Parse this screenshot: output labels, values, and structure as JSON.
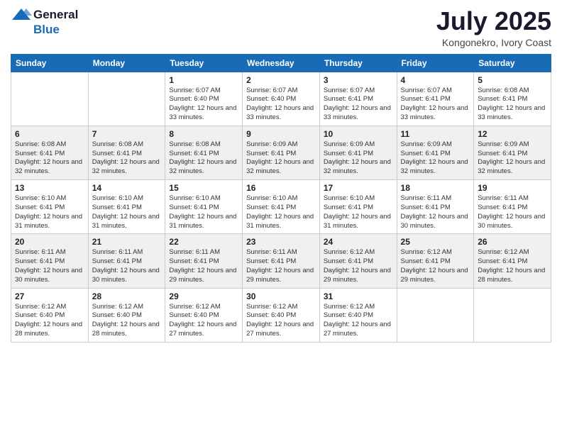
{
  "logo": {
    "general": "General",
    "blue": "Blue"
  },
  "title": {
    "month": "July 2025",
    "location": "Kongonekro, Ivory Coast"
  },
  "weekdays": [
    "Sunday",
    "Monday",
    "Tuesday",
    "Wednesday",
    "Thursday",
    "Friday",
    "Saturday"
  ],
  "weeks": [
    [
      {
        "day": "",
        "detail": ""
      },
      {
        "day": "",
        "detail": ""
      },
      {
        "day": "1",
        "detail": "Sunrise: 6:07 AM\nSunset: 6:40 PM\nDaylight: 12 hours and 33 minutes."
      },
      {
        "day": "2",
        "detail": "Sunrise: 6:07 AM\nSunset: 6:40 PM\nDaylight: 12 hours and 33 minutes."
      },
      {
        "day": "3",
        "detail": "Sunrise: 6:07 AM\nSunset: 6:41 PM\nDaylight: 12 hours and 33 minutes."
      },
      {
        "day": "4",
        "detail": "Sunrise: 6:07 AM\nSunset: 6:41 PM\nDaylight: 12 hours and 33 minutes."
      },
      {
        "day": "5",
        "detail": "Sunrise: 6:08 AM\nSunset: 6:41 PM\nDaylight: 12 hours and 33 minutes."
      }
    ],
    [
      {
        "day": "6",
        "detail": "Sunrise: 6:08 AM\nSunset: 6:41 PM\nDaylight: 12 hours and 32 minutes."
      },
      {
        "day": "7",
        "detail": "Sunrise: 6:08 AM\nSunset: 6:41 PM\nDaylight: 12 hours and 32 minutes."
      },
      {
        "day": "8",
        "detail": "Sunrise: 6:08 AM\nSunset: 6:41 PM\nDaylight: 12 hours and 32 minutes."
      },
      {
        "day": "9",
        "detail": "Sunrise: 6:09 AM\nSunset: 6:41 PM\nDaylight: 12 hours and 32 minutes."
      },
      {
        "day": "10",
        "detail": "Sunrise: 6:09 AM\nSunset: 6:41 PM\nDaylight: 12 hours and 32 minutes."
      },
      {
        "day": "11",
        "detail": "Sunrise: 6:09 AM\nSunset: 6:41 PM\nDaylight: 12 hours and 32 minutes."
      },
      {
        "day": "12",
        "detail": "Sunrise: 6:09 AM\nSunset: 6:41 PM\nDaylight: 12 hours and 32 minutes."
      }
    ],
    [
      {
        "day": "13",
        "detail": "Sunrise: 6:10 AM\nSunset: 6:41 PM\nDaylight: 12 hours and 31 minutes."
      },
      {
        "day": "14",
        "detail": "Sunrise: 6:10 AM\nSunset: 6:41 PM\nDaylight: 12 hours and 31 minutes."
      },
      {
        "day": "15",
        "detail": "Sunrise: 6:10 AM\nSunset: 6:41 PM\nDaylight: 12 hours and 31 minutes."
      },
      {
        "day": "16",
        "detail": "Sunrise: 6:10 AM\nSunset: 6:41 PM\nDaylight: 12 hours and 31 minutes."
      },
      {
        "day": "17",
        "detail": "Sunrise: 6:10 AM\nSunset: 6:41 PM\nDaylight: 12 hours and 31 minutes."
      },
      {
        "day": "18",
        "detail": "Sunrise: 6:11 AM\nSunset: 6:41 PM\nDaylight: 12 hours and 30 minutes."
      },
      {
        "day": "19",
        "detail": "Sunrise: 6:11 AM\nSunset: 6:41 PM\nDaylight: 12 hours and 30 minutes."
      }
    ],
    [
      {
        "day": "20",
        "detail": "Sunrise: 6:11 AM\nSunset: 6:41 PM\nDaylight: 12 hours and 30 minutes."
      },
      {
        "day": "21",
        "detail": "Sunrise: 6:11 AM\nSunset: 6:41 PM\nDaylight: 12 hours and 30 minutes."
      },
      {
        "day": "22",
        "detail": "Sunrise: 6:11 AM\nSunset: 6:41 PM\nDaylight: 12 hours and 29 minutes."
      },
      {
        "day": "23",
        "detail": "Sunrise: 6:11 AM\nSunset: 6:41 PM\nDaylight: 12 hours and 29 minutes."
      },
      {
        "day": "24",
        "detail": "Sunrise: 6:12 AM\nSunset: 6:41 PM\nDaylight: 12 hours and 29 minutes."
      },
      {
        "day": "25",
        "detail": "Sunrise: 6:12 AM\nSunset: 6:41 PM\nDaylight: 12 hours and 29 minutes."
      },
      {
        "day": "26",
        "detail": "Sunrise: 6:12 AM\nSunset: 6:41 PM\nDaylight: 12 hours and 28 minutes."
      }
    ],
    [
      {
        "day": "27",
        "detail": "Sunrise: 6:12 AM\nSunset: 6:40 PM\nDaylight: 12 hours and 28 minutes."
      },
      {
        "day": "28",
        "detail": "Sunrise: 6:12 AM\nSunset: 6:40 PM\nDaylight: 12 hours and 28 minutes."
      },
      {
        "day": "29",
        "detail": "Sunrise: 6:12 AM\nSunset: 6:40 PM\nDaylight: 12 hours and 27 minutes."
      },
      {
        "day": "30",
        "detail": "Sunrise: 6:12 AM\nSunset: 6:40 PM\nDaylight: 12 hours and 27 minutes."
      },
      {
        "day": "31",
        "detail": "Sunrise: 6:12 AM\nSunset: 6:40 PM\nDaylight: 12 hours and 27 minutes."
      },
      {
        "day": "",
        "detail": ""
      },
      {
        "day": "",
        "detail": ""
      }
    ]
  ]
}
